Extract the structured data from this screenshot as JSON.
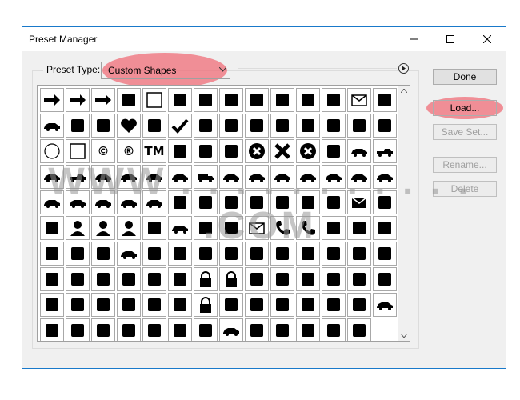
{
  "window": {
    "title": "Preset Manager"
  },
  "preset_type": {
    "label": "Preset Type:",
    "value": "Custom Shapes"
  },
  "buttons": {
    "done": "Done",
    "load": "Load...",
    "save_set": "Save Set...",
    "rename": "Rename...",
    "delete": "Delete"
  },
  "watermark": "WWW . . . . . . . . . . . .COM",
  "highlight_color": "#f06e78",
  "shapes": [
    "arrow-thin",
    "arrow-medium",
    "arrow-bold",
    "banner",
    "frame-square",
    "music-notes",
    "music-note",
    "lightning",
    "starburst",
    "grass",
    "light-bulb",
    "thumbtack",
    "envelope",
    "scissors",
    "blank-card",
    "fleur-de-lis",
    "snail",
    "heart",
    "puzzle-piece",
    "checkmark",
    "target",
    "no-sign",
    "speech-bubble",
    "diagonal-lines",
    "diamond-grid",
    "grid",
    "burst",
    "paw-print",
    "circle-frame",
    "square-frame",
    "copyright",
    "registered",
    "trademark",
    "tree",
    "sparkle-tree",
    "home",
    "close-circle",
    "cross",
    "close-circle-2",
    "crowd",
    "car",
    "pickup",
    "sedan",
    "pickup-2",
    "suv",
    "van",
    "car-2",
    "car-3",
    "truck",
    "car-4",
    "car-5",
    "car-6",
    "car-7",
    "car-8",
    "car-9",
    "car-10",
    "car-11",
    "car-12",
    "car-13",
    "car-14",
    "car-15",
    "people",
    "facebook",
    "twitter",
    "share",
    "rss",
    "bird",
    "chat",
    "mail",
    "pencil",
    "pen-nib",
    "user",
    "user-tie",
    "user-female",
    "trash",
    "cart",
    "book",
    "newspaper",
    "envelope-open",
    "phone",
    "phone-2",
    "mobile",
    "tablet",
    "ipod",
    "monitor",
    "bag",
    "briefcase",
    "credit-card",
    "wallet",
    "gift",
    "idea",
    "tools",
    "calendar",
    "notebook",
    "laptop",
    "router",
    "speaker",
    "browser",
    "server",
    "disc",
    "keyboard",
    "lifebuoy",
    "first-aid",
    "cone",
    "lock",
    "unlock",
    "key",
    "info",
    "paperclip",
    "clipboard",
    "clipboard-2",
    "mouse",
    "cd",
    "floppy",
    "chip",
    "plug",
    "plug-2",
    "outlet",
    "clock",
    "stopwatch",
    "cutlery",
    "mug",
    "beer",
    "wine",
    "cocktail",
    "id-card",
    "document",
    "network",
    "socket",
    "printer",
    "camera",
    "picture",
    "eye",
    "sd-card",
    "jar",
    "lollipop",
    "drop",
    "flask",
    "puzzle"
  ]
}
